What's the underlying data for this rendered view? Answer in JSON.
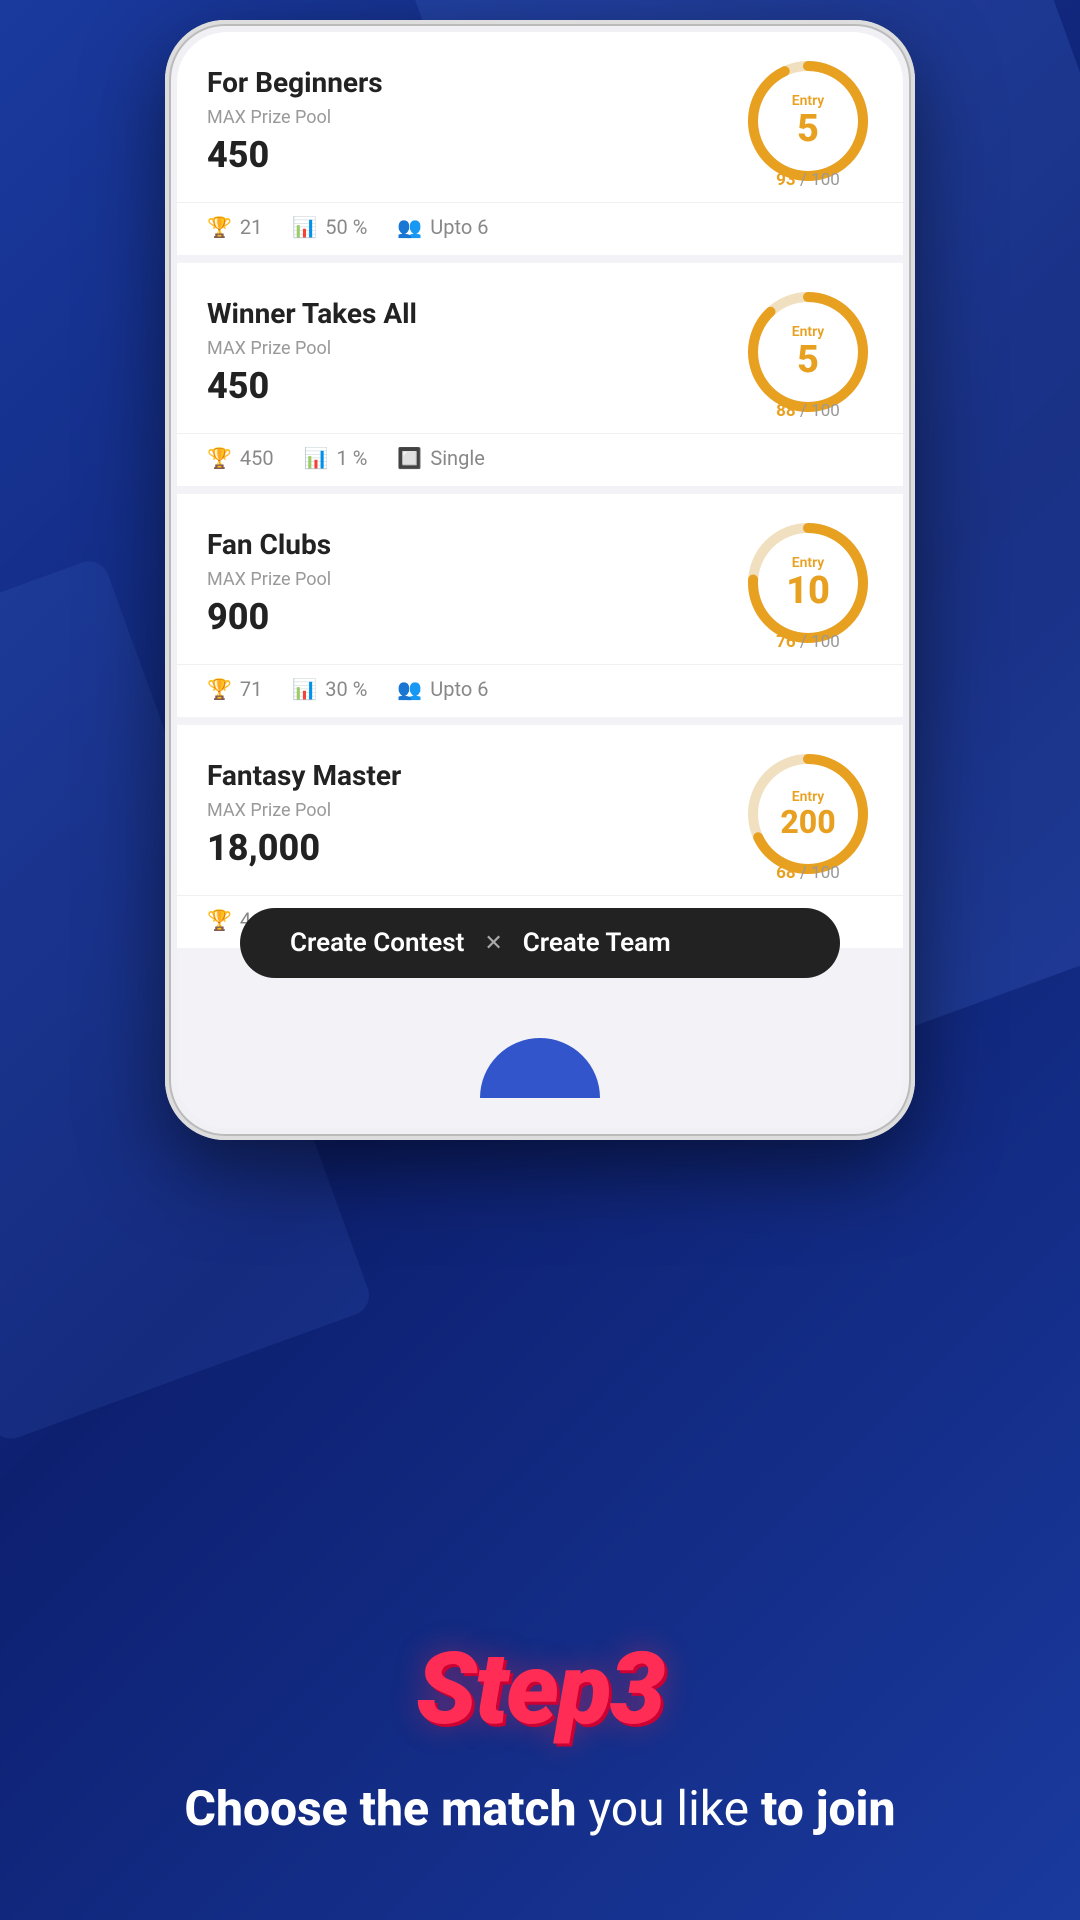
{
  "background": {
    "color": "#1a3a9e"
  },
  "contests": [
    {
      "id": "beginners",
      "title": "For Beginners",
      "subtitle": "MAX Prize Pool",
      "prize": "450",
      "entry": "5",
      "filled": 93,
      "total": 100,
      "stats": [
        {
          "icon": "trophy",
          "value": "21"
        },
        {
          "icon": "chart",
          "value": "50 %"
        },
        {
          "icon": "team",
          "value": "Upto 6"
        }
      ]
    },
    {
      "id": "winner-takes-all",
      "title": "Winner Takes All",
      "subtitle": "MAX Prize Pool",
      "prize": "450",
      "entry": "5",
      "filled": 88,
      "total": 100,
      "stats": [
        {
          "icon": "trophy",
          "value": "450"
        },
        {
          "icon": "chart",
          "value": "1 %"
        },
        {
          "icon": "team",
          "value": "Single"
        }
      ]
    },
    {
      "id": "fan-clubs",
      "title": "Fan Clubs",
      "subtitle": "MAX Prize Pool",
      "prize": "900",
      "entry": "10",
      "filled": 76,
      "total": 100,
      "stats": [
        {
          "icon": "trophy",
          "value": "71"
        },
        {
          "icon": "chart",
          "value": "30 %"
        },
        {
          "icon": "team",
          "value": "Upto 6"
        }
      ]
    },
    {
      "id": "fantasy-master",
      "title": "Fantasy Master",
      "subtitle": "MAX Prize Pool",
      "prize": "18,000",
      "entry": "200",
      "filled": 68,
      "total": 100,
      "stats": [
        {
          "icon": "trophy",
          "value": "4..."
        },
        {
          "icon": "chart",
          "value": ""
        },
        {
          "icon": "team",
          "value": ""
        }
      ]
    }
  ],
  "bottomBar": {
    "createContest": "Create Contest",
    "divider": "✕",
    "createTeam": "Create Team"
  },
  "stepSection": {
    "title": "Step3",
    "subtitle_bold1": "Choose the match",
    "subtitle_normal": " you like ",
    "subtitle_bold2": "to join"
  }
}
